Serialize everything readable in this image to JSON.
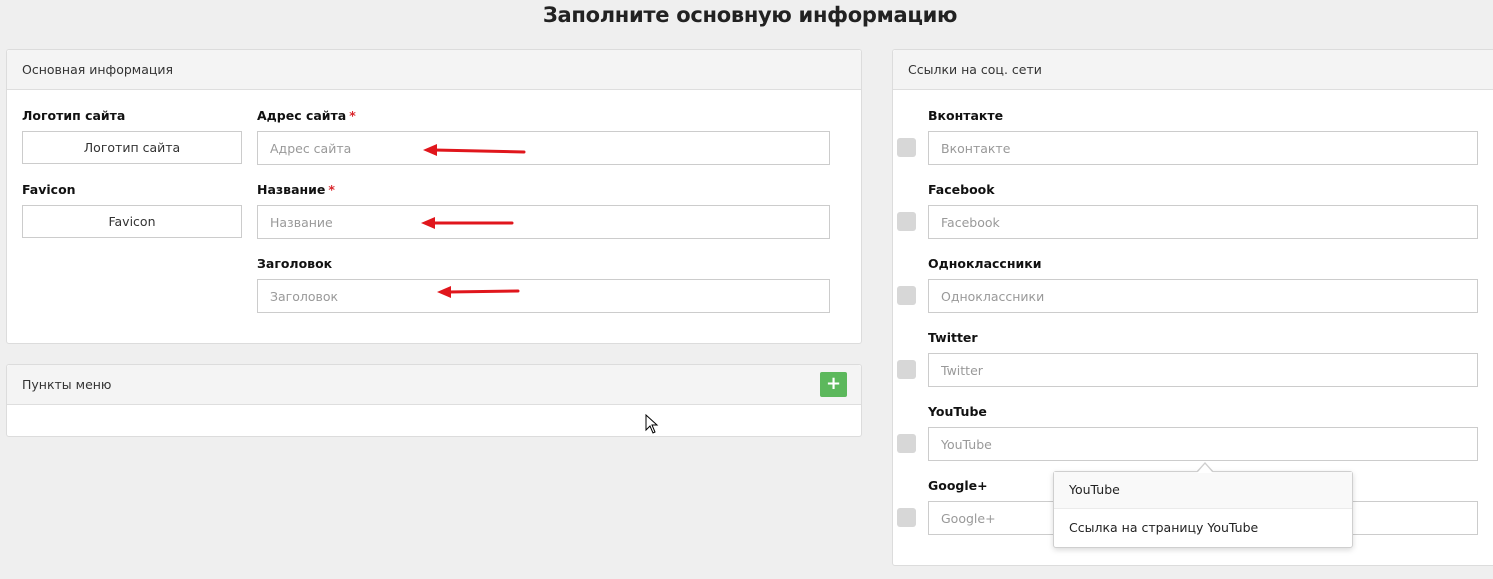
{
  "page": {
    "title": "Заполните основную информацию"
  },
  "basic": {
    "header": "Основная информация",
    "logo_label": "Логотип сайта",
    "logo_button": "Логотип сайта",
    "favicon_label": "Favicon",
    "favicon_button": "Favicon",
    "address_label": "Адрес сайта",
    "address_placeholder": "Адрес сайта",
    "name_label": "Название",
    "name_placeholder": "Название",
    "heading_label": "Заголовок",
    "heading_placeholder": "Заголовок",
    "required_mark": "*"
  },
  "menu": {
    "header": "Пункты меню",
    "add_icon": "+"
  },
  "social": {
    "header": "Ссылки на соц. сети",
    "items": [
      {
        "label": "Вконтакте",
        "placeholder": "Вконтакте"
      },
      {
        "label": "Facebook",
        "placeholder": "Facebook"
      },
      {
        "label": "Одноклассники",
        "placeholder": "Одноклассники"
      },
      {
        "label": "Twitter",
        "placeholder": "Twitter"
      },
      {
        "label": "YouTube",
        "placeholder": "YouTube"
      },
      {
        "label": "Google+",
        "placeholder": "Google+"
      }
    ]
  },
  "popover": {
    "title": "YouTube",
    "body": "Ссылка на страницу YouTube"
  },
  "colors": {
    "accent_green": "#5cb85c",
    "arrow_red": "#e0161c",
    "required_red": "#d9262c"
  }
}
